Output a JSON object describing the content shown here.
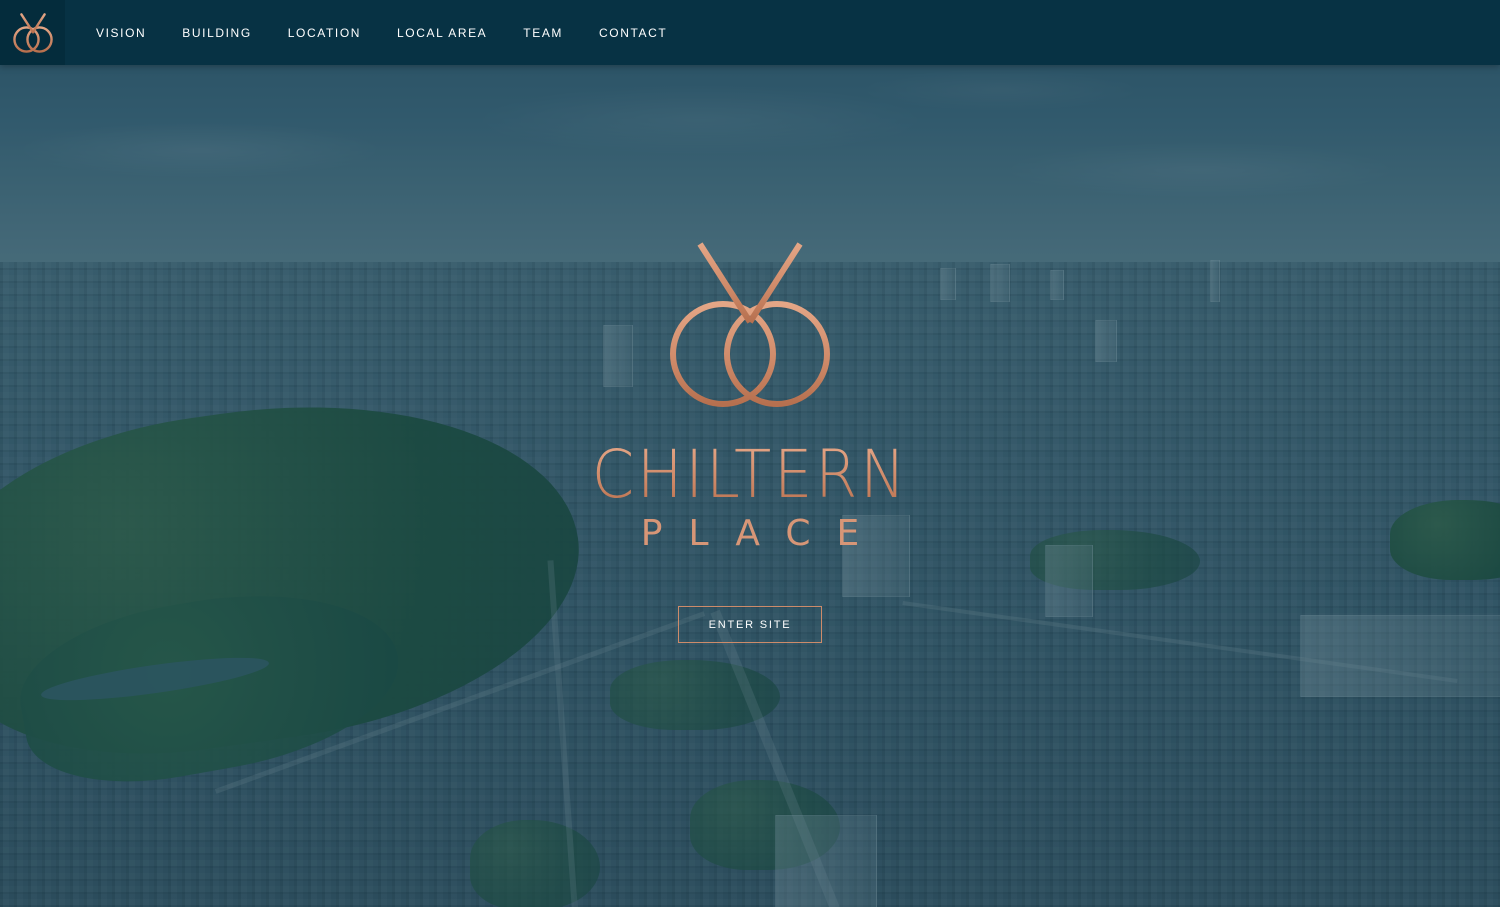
{
  "brand": {
    "logo_icon": "chiltern-rings-logo-icon",
    "name": "CHILTERN",
    "subtitle": "PLACE",
    "accent_color": "#d08c6b"
  },
  "nav": {
    "background": "#073244",
    "items": [
      {
        "label": "VISION"
      },
      {
        "label": "BUILDING"
      },
      {
        "label": "LOCATION"
      },
      {
        "label": "LOCAL AREA"
      },
      {
        "label": "TEAM"
      },
      {
        "label": "CONTACT"
      }
    ]
  },
  "hero": {
    "emblem_icon": "chiltern-rings-emblem-icon",
    "background": "aerial-city-photo",
    "cta_label": "ENTER SITE"
  }
}
